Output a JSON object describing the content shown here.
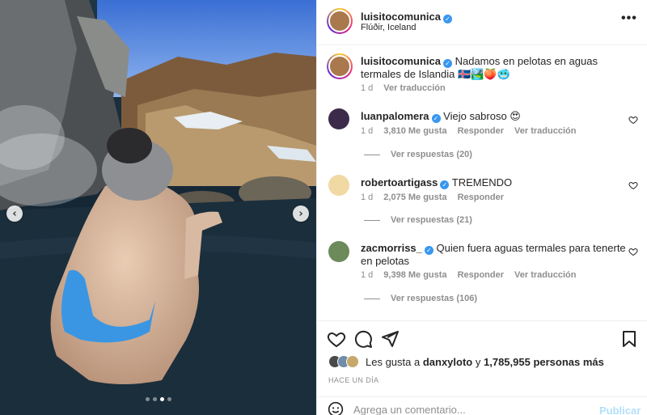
{
  "colors": {
    "accent": "#0095f6",
    "verified": "#3897f0",
    "muted": "#8e8e8e",
    "text": "#262626",
    "publish_disabled": "#b2dffc"
  },
  "media": {
    "carousel_dots": 4,
    "active_dot": 3,
    "prev_icon": "chevron-left-icon",
    "next_icon": "chevron-right-icon"
  },
  "header": {
    "username": "luisitocomunica",
    "location": "Flúðir, Iceland",
    "more_icon": "more-options-icon"
  },
  "caption": {
    "username": "luisitocomunica",
    "text": "Nadamos en pelotas en aguas termales de Islandia 🇮🇸🏞️🍑🥶",
    "time": "1 d",
    "translate": "Ver traducción"
  },
  "comments": [
    {
      "username": "luanpalomera",
      "verified": true,
      "text": "Viejo sabroso 😍",
      "time": "1 d",
      "likes": "3,810 Me gusta",
      "reply": "Responder",
      "translate": "Ver traducción",
      "view_replies": "Ver respuestas (20)"
    },
    {
      "username": "robertoartigass",
      "verified": true,
      "text": "TREMENDO",
      "time": "1 d",
      "likes": "2,075 Me gusta",
      "reply": "Responder",
      "translate": "",
      "view_replies": "Ver respuestas (21)"
    },
    {
      "username": "zacmorriss_",
      "verified": true,
      "text": "Quien fuera aguas termales para tenerte en pelotas",
      "time": "1 d",
      "likes": "9,398 Me gusta",
      "reply": "Responder",
      "translate": "Ver traducción",
      "view_replies": "Ver respuestas (106)"
    }
  ],
  "actions": {
    "likes_prefix": "Les gusta a",
    "likes_user": "danxyloto",
    "likes_conj": "y",
    "likes_count": "1,785,955 personas más",
    "posted": "HACE UN DÍA"
  },
  "add_comment": {
    "placeholder": "Agrega un comentario...",
    "publish": "Publicar"
  }
}
